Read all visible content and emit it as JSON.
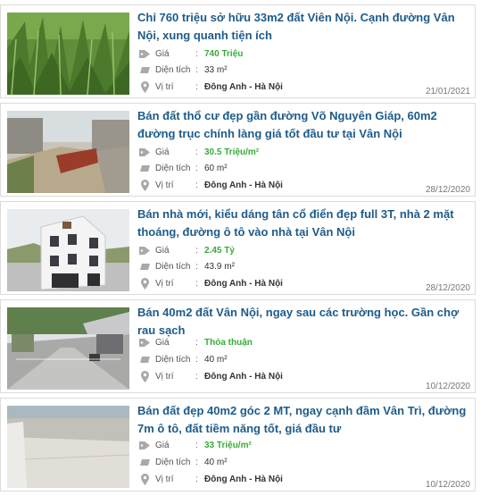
{
  "listings": [
    {
      "title": "Chỉ 760 triệu sở hữu 33m2 đất Viên Nội. Cạnh đường Vân Nội, xung quanh tiện ích",
      "price_label": "Giá",
      "price": "740 Triệu",
      "area_label": "Diện tích",
      "area": "33 m²",
      "location_label": "Vị trí",
      "location": "Đông Anh - Hà Nội",
      "date": "21/01/2021"
    },
    {
      "title": "Bán đất thổ cư đẹp gần đường Võ Nguyên Giáp, 60m2 đường trục chính làng giá tốt đầu tư tại Vân Nội",
      "price_label": "Giá",
      "price": "30.5 Triệu/m²",
      "area_label": "Diện tích",
      "area": "60 m²",
      "location_label": "Vị trí",
      "location": "Đông Anh - Hà Nội",
      "date": "28/12/2020"
    },
    {
      "title": "Bán nhà mới, kiểu dáng tân cổ điển đẹp full 3T, nhà 2 mặt thoáng, đường ô tô vào nhà tại Vân Nội",
      "price_label": "Giá",
      "price": "2.45 Tỷ",
      "area_label": "Diện tích",
      "area": "43.9 m²",
      "location_label": "Vị trí",
      "location": "Đông Anh - Hà Nội",
      "date": "28/12/2020"
    },
    {
      "title": "Bán 40m2 đất Vân Nội, ngay sau các trường học. Gần chợ rau sạch",
      "price_label": "Giá",
      "price": "Thỏa thuận",
      "area_label": "Diện tích",
      "area": "40 m²",
      "location_label": "Vị trí",
      "location": "Đông Anh - Hà Nội",
      "date": "10/12/2020"
    },
    {
      "title": "Bán đất đẹp 40m2 góc 2 MT, ngay cạnh đầm Vân Trì, đường 7m ô tô, đất tiềm năng tốt, giá đầu tư",
      "price_label": "Giá",
      "price": "33 Triệu/m²",
      "area_label": "Diện tích",
      "area": "40 m²",
      "location_label": "Vị trí",
      "location": "Đông Anh - Hà Nội",
      "date": "10/12/2020"
    }
  ],
  "icons": {
    "price": "price-tag-icon",
    "area": "area-icon",
    "location": "map-pin-icon"
  },
  "colors": {
    "title": "#1e5b8a",
    "price": "#3aa93a",
    "border": "#dcdcdc"
  }
}
